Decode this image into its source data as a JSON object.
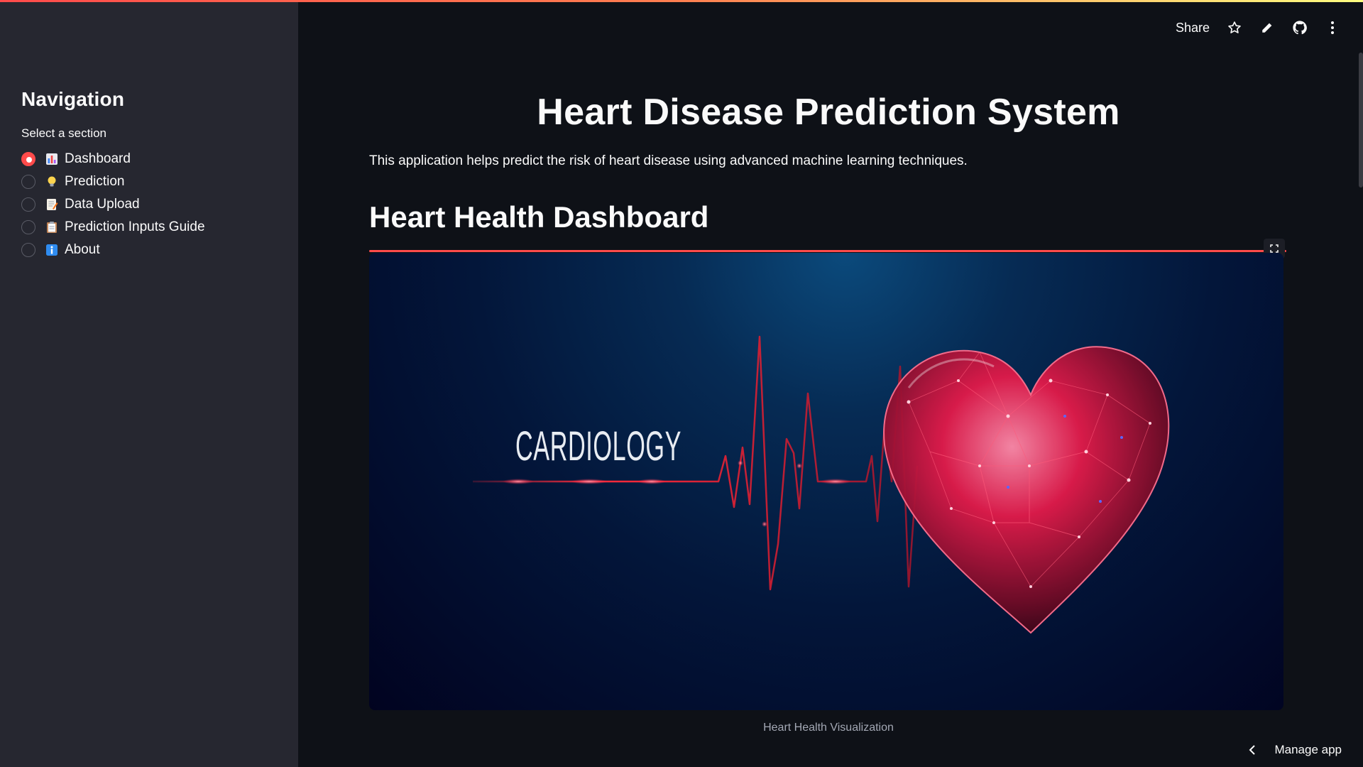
{
  "sidebar": {
    "title": "Navigation",
    "radio_label": "Select a section",
    "items": [
      {
        "label": "Dashboard",
        "icon": "bar-chart-icon",
        "checked": true
      },
      {
        "label": "Prediction",
        "icon": "lightbulb-icon",
        "checked": false
      },
      {
        "label": "Data Upload",
        "icon": "memo-icon",
        "checked": false
      },
      {
        "label": "Prediction Inputs Guide",
        "icon": "clipboard-icon",
        "checked": false
      },
      {
        "label": "About",
        "icon": "info-icon",
        "checked": false
      }
    ]
  },
  "toolbar": {
    "share_label": "Share",
    "icons": [
      "star-icon",
      "pencil-icon",
      "github-icon",
      "kebab-menu-icon"
    ]
  },
  "main": {
    "title": "Heart Disease Prediction System",
    "description": "This application helps predict the risk of heart disease using advanced machine learning techniques.",
    "section_header": "Heart Health Dashboard",
    "image_text": "CARDIOLOGY",
    "image_caption": "Heart Health Visualization"
  },
  "footer": {
    "manage_label": "Manage app"
  },
  "colors": {
    "accent": "#ff4b4b",
    "sidebar_bg": "#262730",
    "main_bg": "#0e1117"
  }
}
